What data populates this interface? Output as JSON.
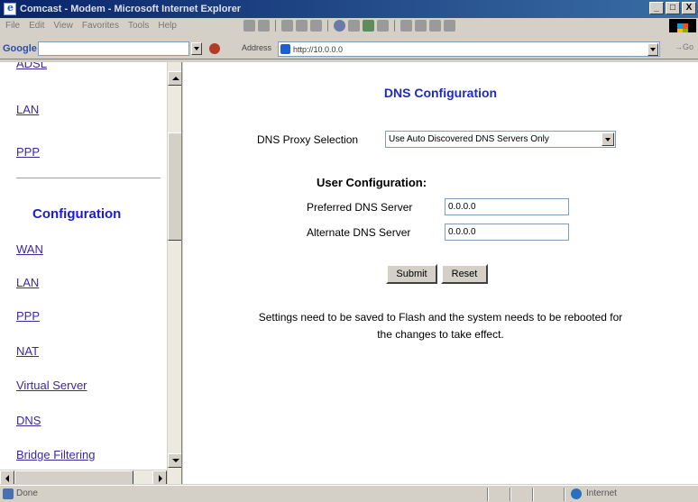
{
  "window": {
    "title": "Comcast - Modem - Microsoft Internet Explorer",
    "buttons": {
      "minimize": "_",
      "maximize": "□",
      "close": "X"
    }
  },
  "menubar": {
    "items": [
      "File",
      "Edit",
      "View",
      "Favorites",
      "Tools",
      "Help"
    ]
  },
  "googlebar": {
    "label": "Google -",
    "search_value": ""
  },
  "addressbar": {
    "label": "Address",
    "value": "http://10.0.0.0",
    "go_label": "Go"
  },
  "sidebar": {
    "top_links": [
      "ADSL",
      "LAN",
      "PPP"
    ],
    "section_title": "Configuration",
    "config_links": [
      "WAN",
      "LAN",
      "PPP",
      "NAT",
      "Virtual Server",
      "DNS",
      "Bridge Filtering"
    ]
  },
  "main": {
    "title": "DNS Configuration",
    "proxy_label": "DNS Proxy Selection",
    "proxy_selected": "Use Auto Discovered DNS Servers Only",
    "user_config_label": "User Configuration:",
    "preferred_label": "Preferred DNS Server",
    "preferred_value": "0.0.0.0",
    "alternate_label": "Alternate DNS Server",
    "alternate_value": "0.0.0.0",
    "submit_label": "Submit",
    "reset_label": "Reset",
    "note_line1": "Settings need to be saved to Flash and the system needs to be rebooted for",
    "note_line2": "the changes to take effect."
  },
  "statusbar": {
    "status": "Done",
    "zone": "Internet"
  }
}
